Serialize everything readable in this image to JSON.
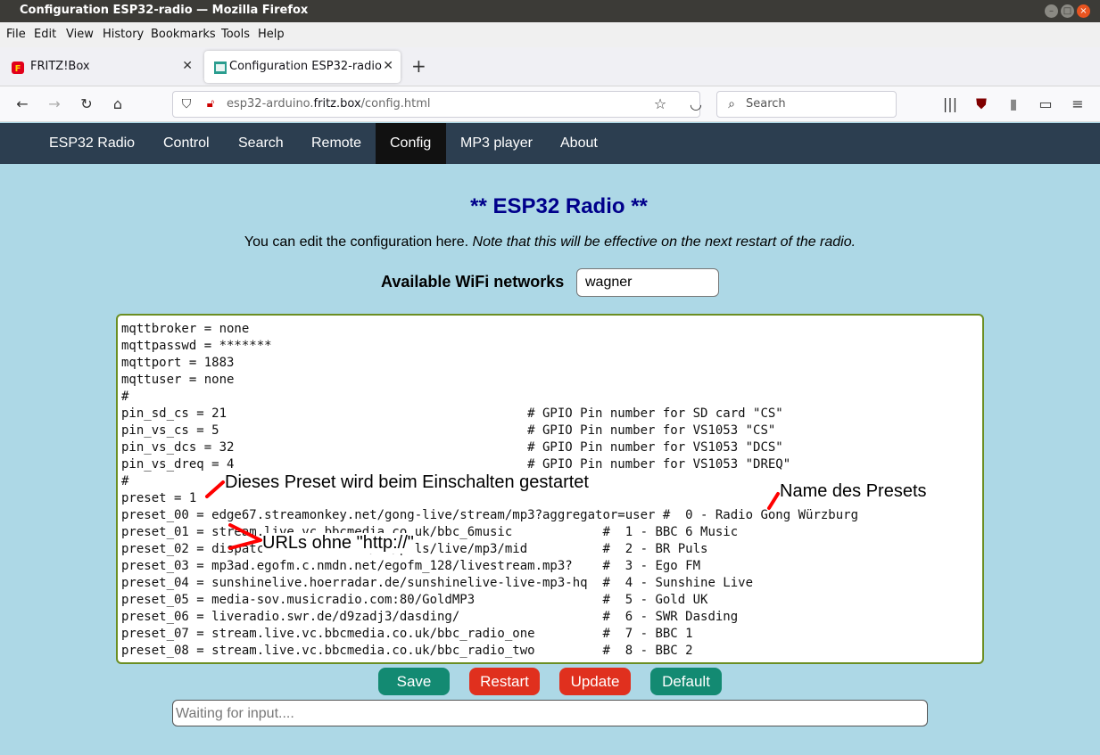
{
  "window": {
    "title": "Configuration ESP32-radio — Mozilla Firefox"
  },
  "menu": [
    "File",
    "Edit",
    "View",
    "History",
    "Bookmarks",
    "Tools",
    "Help"
  ],
  "tabs": [
    {
      "label": "FRITZ!Box",
      "active": false
    },
    {
      "label": "Configuration ESP32-radio",
      "active": true
    }
  ],
  "url": {
    "prefix": "esp32-arduino.",
    "domain": "fritz.box",
    "path": "/config.html"
  },
  "search": {
    "placeholder": "Search"
  },
  "site_nav": [
    "ESP32 Radio",
    "Control",
    "Search",
    "Remote",
    "Config",
    "MP3 player",
    "About"
  ],
  "page": {
    "heading": "** ESP32 Radio **",
    "intro_plain": "You can edit the configuration here. ",
    "intro_italic": "Note that this will be effective on the next restart of the radio.",
    "wifi_label": "Available WiFi networks",
    "wifi_selected": "wagner"
  },
  "config_lines": [
    "mqttbroker = none",
    "mqttpasswd = *******",
    "mqttport = 1883",
    "mqttuser = none",
    "#",
    "pin_sd_cs = 21                                        # GPIO Pin number for SD card \"CS\"",
    "pin_vs_cs = 5                                         # GPIO Pin number for VS1053 \"CS\"",
    "pin_vs_dcs = 32                                       # GPIO Pin number for VS1053 \"DCS\"",
    "pin_vs_dreq = 4                                       # GPIO Pin number for VS1053 \"DREQ\"",
    "#",
    "preset = 1",
    "preset_00 = edge67.streamonkey.net/gong-live/stream/mp3?aggregator=user #  0 - Radio Gong Würzburg",
    "preset_01 = stream.live.vc.bbcmedia.co.uk/bbc_6music            #  1 - BBC 6 Music",
    "preset_02 = dispatcher.rndfnk.com/br/puls/live/mp3/mid          #  2 - BR Puls",
    "preset_03 = mp3ad.egofm.c.nmdn.net/egofm_128/livestream.mp3?    #  3 - Ego FM",
    "preset_04 = sunshinelive.hoerradar.de/sunshinelive-live-mp3-hq  #  4 - Sunshine Live",
    "preset_05 = media-sov.musicradio.com:80/GoldMP3                 #  5 - Gold UK",
    "preset_06 = liveradio.swr.de/d9zadj3/dasding/                   #  6 - SWR Dasding",
    "preset_07 = stream.live.vc.bbcmedia.co.uk/bbc_radio_one         #  7 - BBC 1",
    "preset_08 = stream.live.vc.bbcmedia.co.uk/bbc_radio_two         #  8 - BBC 2"
  ],
  "annotations": {
    "preset_note": "Dieses Preset wird beim Einschalten gestartet",
    "name_note": "Name des Presets",
    "url_note": "URLs ohne \"http://\""
  },
  "buttons": {
    "save": "Save",
    "restart": "Restart",
    "update": "Update",
    "default": "Default"
  },
  "status": {
    "placeholder": "Waiting for input...."
  },
  "colors": {
    "site_nav": "#2c3e50",
    "page_bg": "#add8e6",
    "heading": "#00008b",
    "btn_green": "#138a72",
    "btn_red": "#e0301e",
    "annotation_marks": "#ff0000"
  }
}
